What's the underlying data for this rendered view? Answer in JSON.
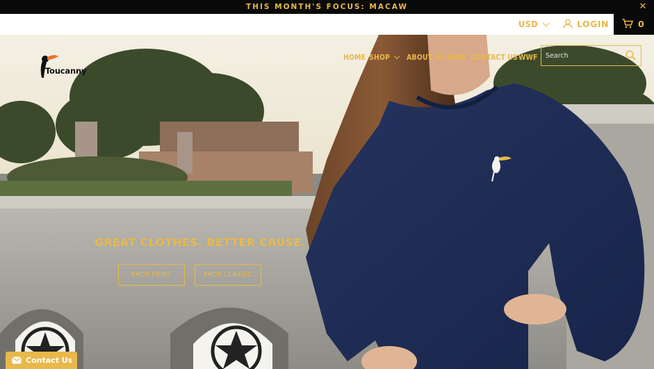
{
  "announcement": {
    "text": "THIS MONTH'S FOCUS: MACAW",
    "close_icon": "close-icon"
  },
  "utility": {
    "currency": "USD",
    "login_label": "LOGIN",
    "cart_count": "0",
    "icons": [
      "user-icon",
      "cart-icon",
      "chevron-down-icon"
    ]
  },
  "brand": {
    "name": "Toucanny"
  },
  "nav": {
    "items": [
      {
        "label": "HOME"
      },
      {
        "label": "SHOP"
      },
      {
        "label": "ABOUT US"
      },
      {
        "label": "FAQS"
      },
      {
        "label": "CONTACT US"
      },
      {
        "label": "WWF"
      }
    ]
  },
  "search": {
    "placeholder": "Search",
    "icon": "search-icon"
  },
  "hero": {
    "tagline": "GREAT CLOTHES. BETTER CAUSE.",
    "buttons": {
      "print_label": "SHOP PRINT",
      "classic_label": "SHOP CLASSIC"
    }
  },
  "contact_widget": {
    "label": "Contact Us",
    "icon": "mail-icon"
  },
  "colors": {
    "accent": "#e9b84a",
    "topbar": "#0a0a0a",
    "sweater": "#1c2a52"
  }
}
